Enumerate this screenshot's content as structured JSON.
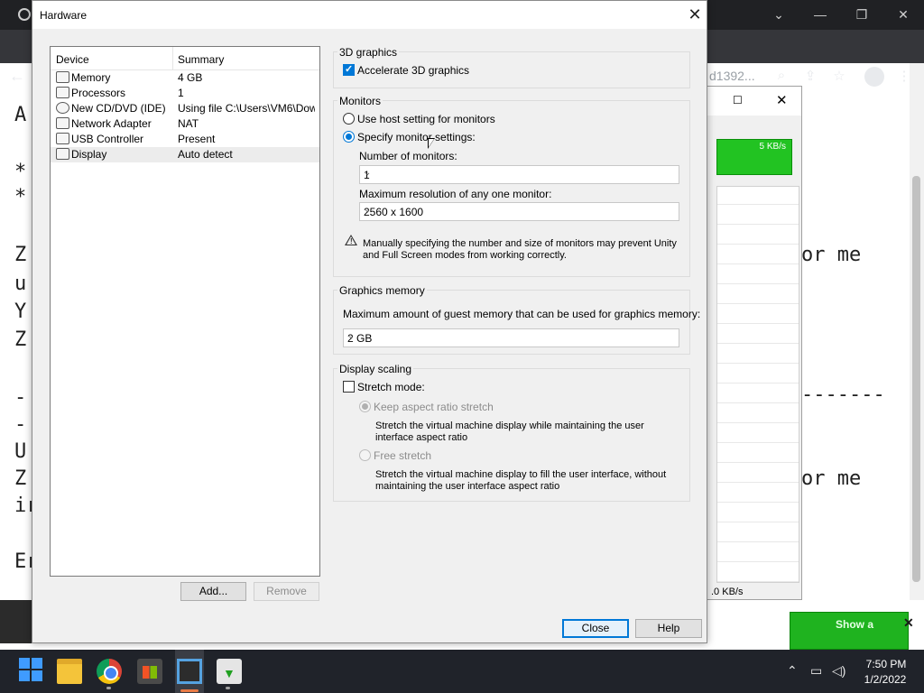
{
  "background": {
    "browser_url_fragment": "d1392...",
    "terminal_lines": [
      "A",
      "*",
      "*",
      "Z",
      "u",
      "Y",
      "Z",
      "-",
      "-",
      "U",
      "Z",
      "ir",
      "Er"
    ],
    "terminal_right_1": "or me",
    "terminal_right_dashes": "-------",
    "terminal_right_2": "or me",
    "monitor_rate_label": "5 KB/s",
    "monitor_status": ".0 KB/s",
    "notification_text": "Show a"
  },
  "dialog": {
    "title": "Hardware",
    "device_list": {
      "col_device": "Device",
      "col_summary": "Summary",
      "rows": [
        {
          "device": "Memory",
          "summary": "4 GB"
        },
        {
          "device": "Processors",
          "summary": "1"
        },
        {
          "device": "New CD/DVD (IDE)",
          "summary": "Using file C:\\Users\\VM6\\Dow..."
        },
        {
          "device": "Network Adapter",
          "summary": "NAT"
        },
        {
          "device": "USB Controller",
          "summary": "Present"
        },
        {
          "device": "Display",
          "summary": "Auto detect"
        }
      ],
      "selected_index": 5
    },
    "add_button": "Add...",
    "remove_button": "Remove",
    "graphics3d": {
      "group_label": "3D graphics",
      "accelerate_label": "Accelerate 3D graphics",
      "accelerate_checked": true
    },
    "monitors": {
      "group_label": "Monitors",
      "use_host_label": "Use host setting for monitors",
      "specify_label": "Specify monitor settings:",
      "num_monitors_label": "Number of monitors:",
      "num_monitors_value": "1",
      "max_res_label": "Maximum resolution of any one monitor:",
      "max_res_value": "2560 x 1600",
      "warning_text": "Manually specifying the number and size of monitors may prevent Unity and Full Screen modes from working correctly."
    },
    "graphics_memory": {
      "group_label": "Graphics memory",
      "desc": "Maximum amount of guest memory that can be used for graphics memory:",
      "value": "2 GB"
    },
    "display_scaling": {
      "group_label": "Display scaling",
      "stretch_label": "Stretch mode:",
      "stretch_checked": false,
      "keep_aspect_label": "Keep aspect ratio stretch",
      "keep_aspect_desc": "Stretch the virtual machine display while maintaining the user interface aspect ratio",
      "free_stretch_label": "Free stretch",
      "free_stretch_desc": "Stretch the virtual machine display to fill the user interface, without maintaining the user interface aspect ratio"
    },
    "close_button": "Close",
    "help_button": "Help"
  },
  "taskbar": {
    "time": "7:50 PM",
    "date": "1/2/2022"
  },
  "colors": {
    "accent": "#0078d7",
    "taskbar": "#20232a",
    "monitor_green": "#22c322"
  }
}
